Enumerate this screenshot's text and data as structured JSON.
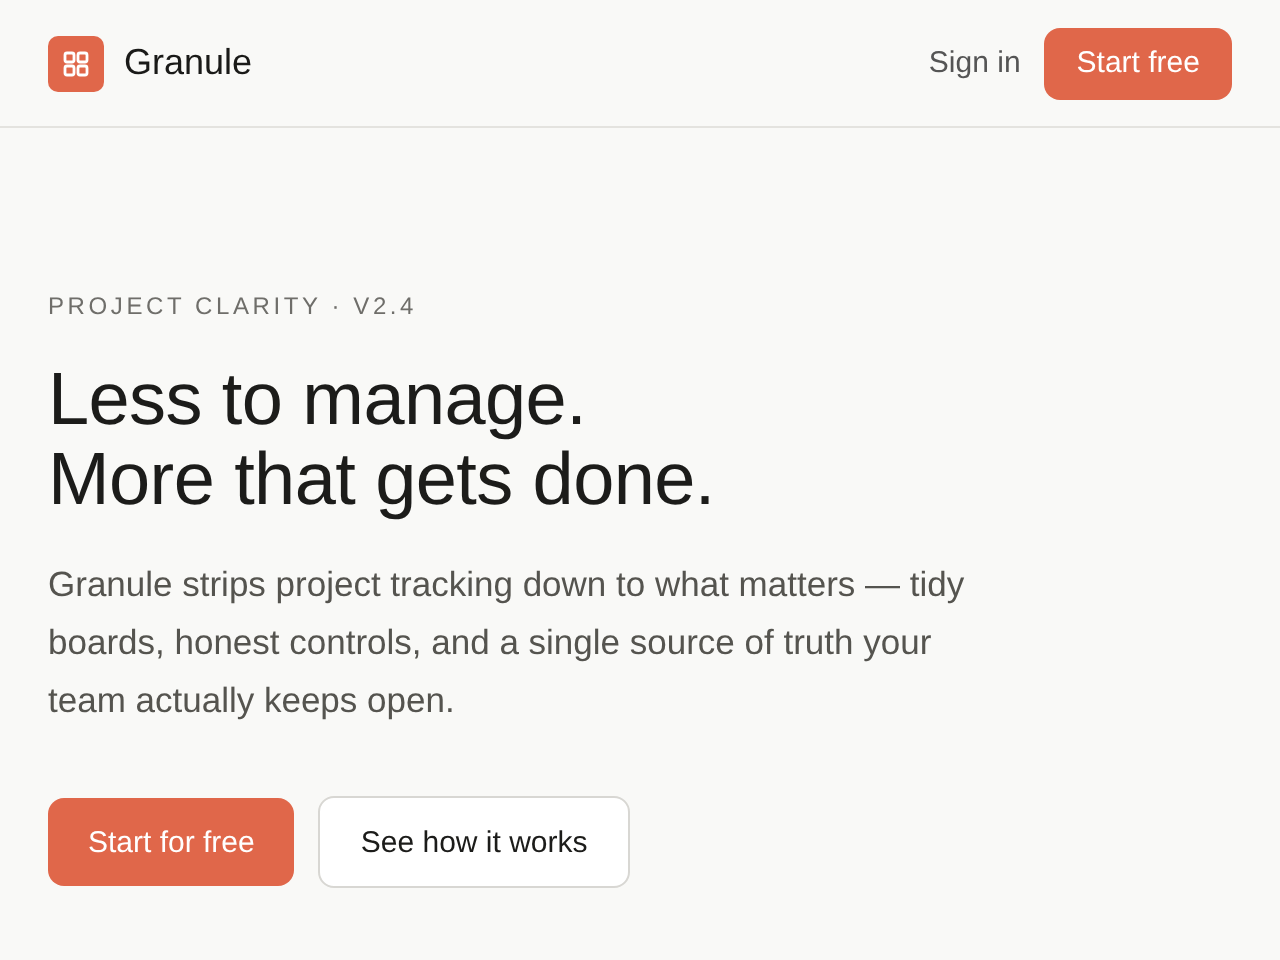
{
  "header": {
    "brand": "Granule",
    "nav": [
      {
        "label": "Sign in",
        "kind": "link"
      },
      {
        "label": "Start free",
        "kind": "primary"
      }
    ]
  },
  "hero": {
    "eyebrow": "PROJECT CLARITY · V2.4",
    "headline": [
      "Less to manage.",
      "More that gets done."
    ],
    "body": "Granule strips project tracking down to what matters — tidy boards, honest controls, and a single source of truth your team actually keeps open.",
    "buttons": [
      {
        "label": "Start for free",
        "kind": "primary"
      },
      {
        "label": "See how it works",
        "kind": "secondary"
      }
    ]
  }
}
